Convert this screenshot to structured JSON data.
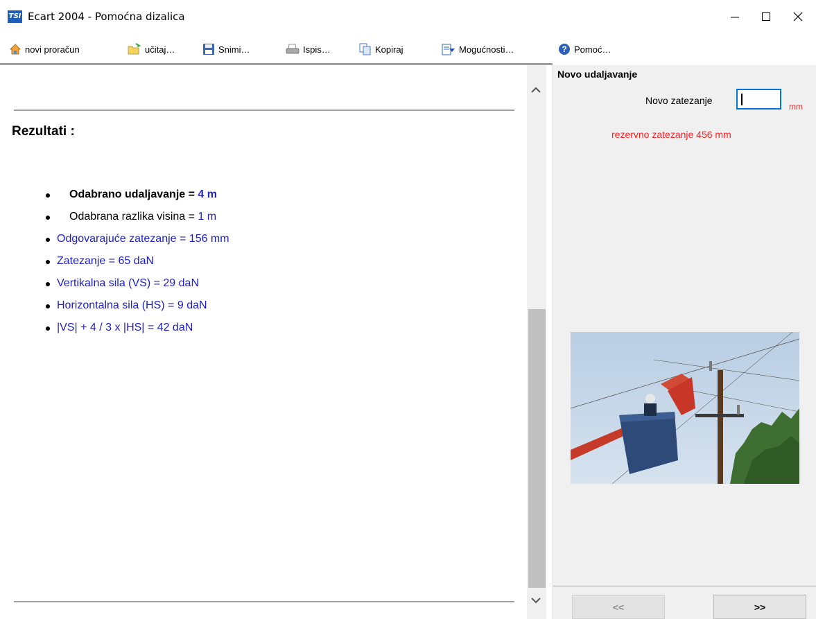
{
  "window": {
    "title": "Ecart 2004 - Pomoćna dizalica",
    "app_icon_text": "TSI"
  },
  "toolbar": {
    "items": [
      {
        "label": "novi proračun",
        "icon": "home-icon"
      },
      {
        "label": "učitaj…",
        "icon": "folder-open-icon"
      },
      {
        "label": "Snimi…",
        "icon": "floppy-disk-icon"
      },
      {
        "label": "Ispis…",
        "icon": "printer-icon"
      },
      {
        "label": "Kopiraj",
        "icon": "copy-icon"
      },
      {
        "label": "Mogućnosti…",
        "icon": "options-icon"
      },
      {
        "label": "Pomoć…",
        "icon": "help-icon"
      }
    ]
  },
  "results": {
    "title": "Rezultati :",
    "items": [
      {
        "label": "Odabrano udaljavanje = ",
        "value": "4 m"
      },
      {
        "label": "Odabrana razlika visina = ",
        "value": "1 m"
      },
      {
        "text": "Odgovarajuće zatezanje = 156 mm"
      },
      {
        "text": "Zatezanje = 65 daN"
      },
      {
        "text": "Vertikalna sila (VS) = 29 daN"
      },
      {
        "text": "Horizontalna sila (HS) = 9 daN"
      },
      {
        "text": "|VS| + 4 / 3 x |HS| = 42 daN"
      }
    ]
  },
  "panel": {
    "title": "Novo udaljavanje",
    "new_tension_label": "Novo zatezanje",
    "new_tension_value": "",
    "unit": "mm",
    "reserve_text": "rezervno zatezanje  456 mm"
  },
  "nav": {
    "prev_label": "<<",
    "next_label": ">>"
  },
  "colors": {
    "accent": "#0078d7",
    "link_blue": "#2020c8",
    "warning_red": "#ff2020"
  }
}
